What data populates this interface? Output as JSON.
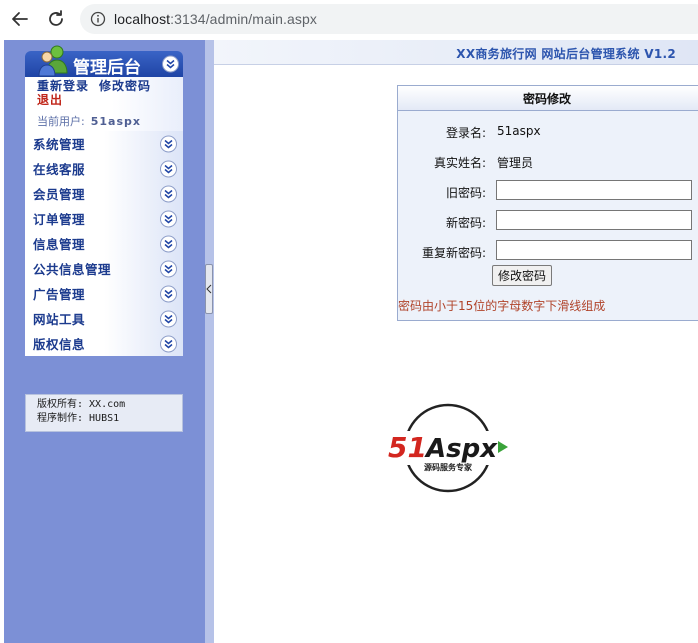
{
  "browser": {
    "url_host": "localhost",
    "url_rest": ":3134/admin/main.aspx"
  },
  "sidebar": {
    "title": "管理后台",
    "relogin": "重新登录",
    "change_password": "修改密码",
    "logout": "退出",
    "current_user_label": "当前用户:",
    "current_user": "51aspx",
    "items": [
      {
        "label": "系统管理"
      },
      {
        "label": "在线客服"
      },
      {
        "label": "会员管理"
      },
      {
        "label": "订单管理"
      },
      {
        "label": "信息管理"
      },
      {
        "label": "公共信息管理"
      },
      {
        "label": "广告管理"
      },
      {
        "label": "网站工具"
      },
      {
        "label": "版权信息"
      }
    ],
    "copyright_owner": "版权所有: XX.com",
    "copyright_maker": "程序制作: HUBS1"
  },
  "header": {
    "system_title": "XX商务旅行网 网站后台管理系统 V1.2"
  },
  "password_panel": {
    "title": "密码修改",
    "login_name_label": "登录名:",
    "login_name": "51aspx",
    "real_name_label": "真实姓名:",
    "real_name": "管理员",
    "old_password_label": "旧密码:",
    "new_password_label": "新密码:",
    "confirm_password_label": "重复新密码:",
    "submit_label": "修改密码",
    "note": "密码由小于15位的字母数字下滑线组成"
  },
  "logo": {
    "brand_red": "51",
    "brand_black": "Aspx",
    "tagline": "源码服务专家"
  },
  "colors": {
    "sidebar_bg": "#7c90d6",
    "menu_text": "#1c3b8e",
    "accent_red": "#c0261a",
    "note_color": "#b0432a",
    "header_title": "#2d55ae"
  }
}
